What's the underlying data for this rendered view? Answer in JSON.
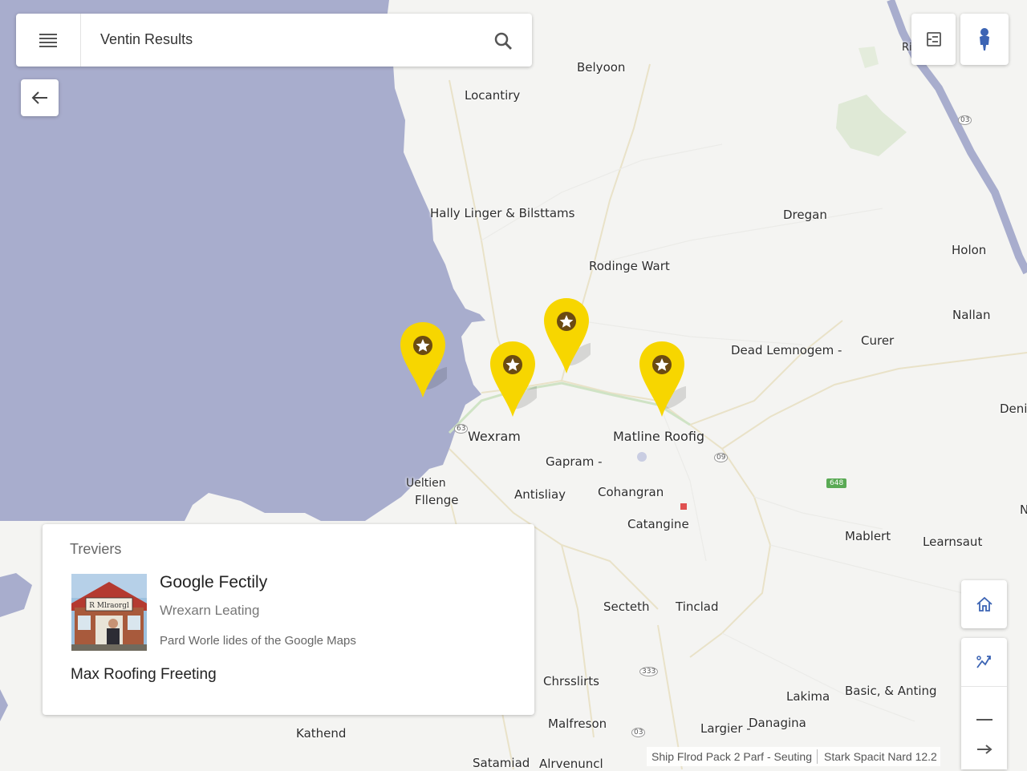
{
  "search": {
    "value": "Ventin Results"
  },
  "places": [
    {
      "label": "Belyoon"
    },
    {
      "label": "Locantiry"
    },
    {
      "label": "Hally Linger & Bilsttams"
    },
    {
      "label": "Dregan"
    },
    {
      "label": "Holon"
    },
    {
      "label": "Rodinge Wart"
    },
    {
      "label": "Nallan"
    },
    {
      "label": "Dead Lemnogem -"
    },
    {
      "label": "Curer"
    },
    {
      "label": "Deni"
    },
    {
      "label": "Wexram"
    },
    {
      "label": "Matline Roofig"
    },
    {
      "label": "Gapram -"
    },
    {
      "label": "Ueltien"
    },
    {
      "label": "Fllenge"
    },
    {
      "label": "Antisliay"
    },
    {
      "label": "Cohangran"
    },
    {
      "label": "Catangine"
    },
    {
      "label": "Mablert"
    },
    {
      "label": "Learnsaut"
    },
    {
      "label": "Secteth"
    },
    {
      "label": "Tinclad"
    },
    {
      "label": "Chrsslirts"
    },
    {
      "label": "Lakima"
    },
    {
      "label": "Basic, & Anting"
    },
    {
      "label": "Malfreson"
    },
    {
      "label": "Largier -"
    },
    {
      "label": "Danagina"
    },
    {
      "label": "Kathend"
    },
    {
      "label": "Satamiad"
    },
    {
      "label": "Alrvenuncl"
    },
    {
      "label": "N"
    },
    {
      "label": "Ri"
    }
  ],
  "road_labels": {
    "shield_648": "648",
    "r1": "63",
    "r2": "09",
    "r3": "333",
    "r4": "03",
    "r5": "03"
  },
  "info_card": {
    "heading": "Treviers",
    "title": "Google Fectily",
    "subtitle": "Wrexarn Leating",
    "description": "Pard Worle lides of the Google Maps",
    "footer": "Max Roofing Freeting",
    "thumb_sign": "R Mlraorgl"
  },
  "attribution": {
    "left": "Ship Flrod Pack 2 Parf - Seuting",
    "right": "Stark Spacit Nard 12.2"
  },
  "colors": {
    "water": "#a8adcd",
    "land": "#f4f4f2",
    "pin": "#f7d600",
    "pin_core": "#6b4b12",
    "park": "#dfe9d6"
  },
  "icons": {
    "menu": "menu-icon",
    "search": "search-icon",
    "back": "arrow-left-icon",
    "layers": "layers-icon",
    "person": "pegman-icon",
    "home": "home-icon",
    "directions": "directions-icon",
    "zoom_out": "minus-icon",
    "arrow": "arrow-right-icon"
  }
}
